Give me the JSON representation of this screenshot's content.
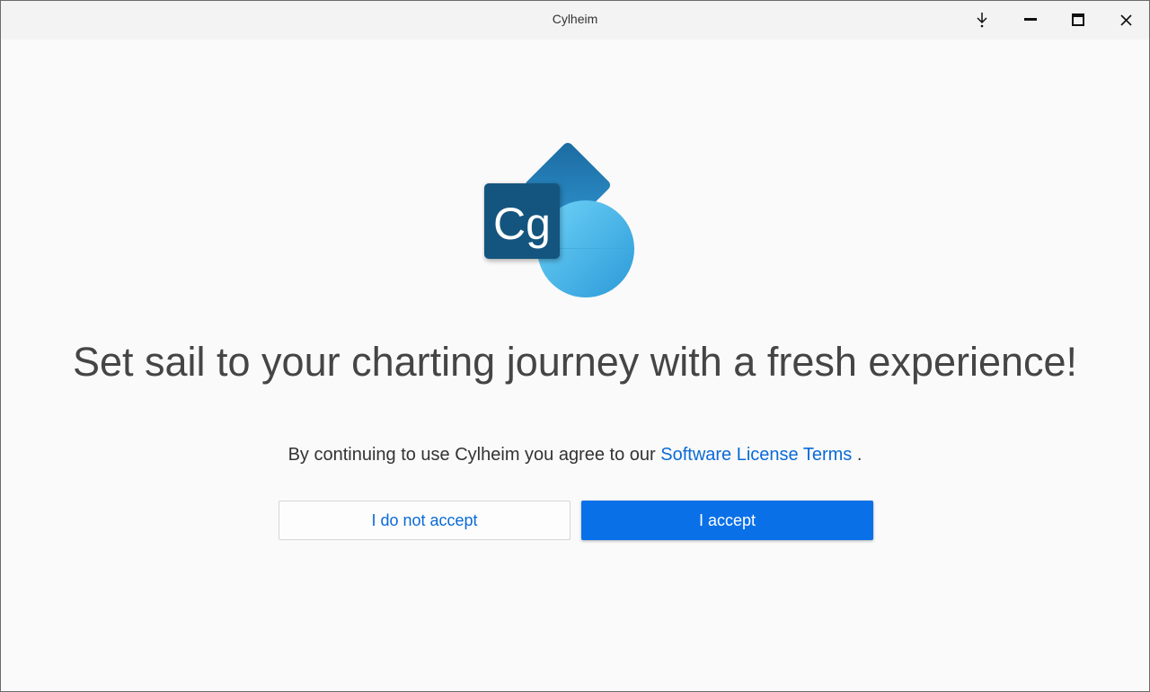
{
  "window": {
    "title": "Cylheim"
  },
  "logo": {
    "text": "Cg"
  },
  "main": {
    "headline": "Set sail to your charting journey with a fresh experience!",
    "agreement_prefix": "By continuing to use Cylheim you agree to our ",
    "license_link": "Software License Terms",
    "agreement_suffix": " .",
    "decline_label": "I do not accept",
    "accept_label": "I accept"
  },
  "colors": {
    "accent": "#0a70e8",
    "link": "#0a6ad6"
  }
}
